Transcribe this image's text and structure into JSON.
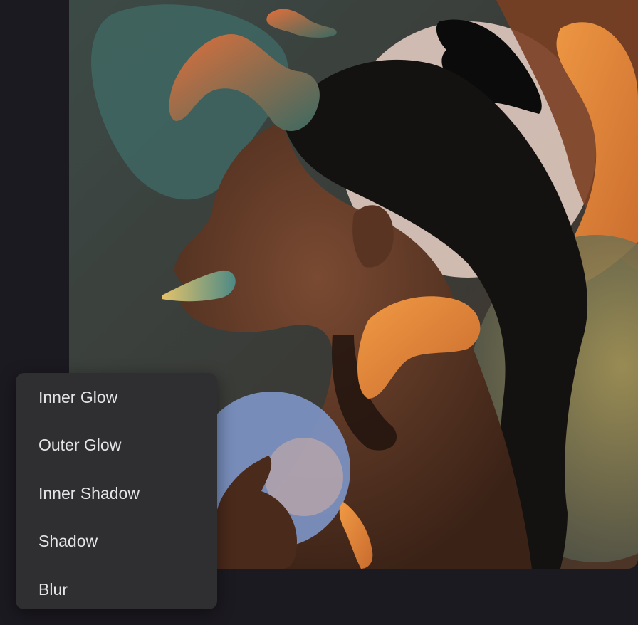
{
  "menu": {
    "items": [
      {
        "label": "Inner Glow"
      },
      {
        "label": "Outer Glow"
      },
      {
        "label": "Inner Shadow"
      },
      {
        "label": "Shadow"
      },
      {
        "label": "Blur"
      }
    ]
  },
  "colors": {
    "background": "#1c1a21",
    "menu_background": "#2f2f31",
    "menu_text": "#e4e4e6",
    "teal": "#3f5a55",
    "orange": "#e9873a",
    "blue": "#7d94c4",
    "cream": "#d8c2b8"
  }
}
